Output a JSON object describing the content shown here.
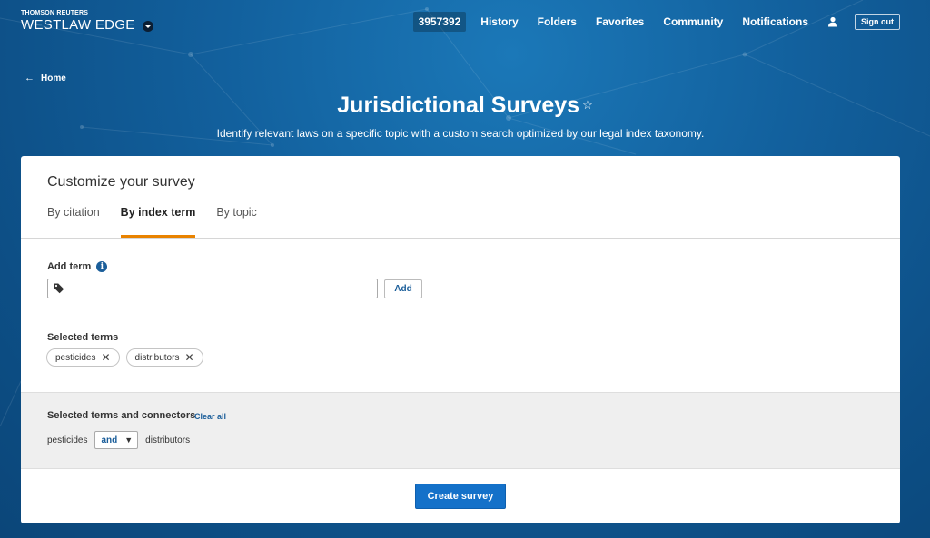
{
  "header": {
    "brand_top": "THOMSON REUTERS",
    "brand_main": "WESTLAW EDGE",
    "nav": {
      "billing_id": "3957392",
      "history": "History",
      "folders": "Folders",
      "favorites": "Favorites",
      "community": "Community",
      "notifications": "Notifications",
      "sign_out": "Sign out"
    }
  },
  "breadcrumb": {
    "home": "Home"
  },
  "page": {
    "title": "Jurisdictional Surveys",
    "star": "☆",
    "subtitle": "Identify relevant laws on a specific topic with a custom search optimized by our legal index taxonomy."
  },
  "survey": {
    "heading": "Customize your survey",
    "tabs": [
      {
        "label": "By citation",
        "active": false
      },
      {
        "label": "By index term",
        "active": true
      },
      {
        "label": "By topic",
        "active": false
      }
    ],
    "add_term_label": "Add term",
    "info_glyph": "i",
    "term_input_value": "",
    "add_button": "Add",
    "selected_terms_label": "Selected terms",
    "selected_terms": [
      "pesticides",
      "distributors"
    ],
    "chip_remove_glyph": "✕",
    "connectors_label": "Selected terms and connectors",
    "clear_all": "Clear all",
    "connector_row": {
      "term1": "pesticides",
      "connector": "and",
      "term2": "distributors"
    },
    "caret_glyph": "▼",
    "create_button": "Create survey"
  },
  "colors": {
    "accent_tab": "#e98300",
    "primary_button": "#1471c9",
    "link": "#1b5e9a"
  },
  "icons": {
    "back": "left-arrow-icon",
    "user": "user-icon",
    "tag": "tag-icon",
    "info": "info-icon",
    "remove": "close-icon"
  }
}
